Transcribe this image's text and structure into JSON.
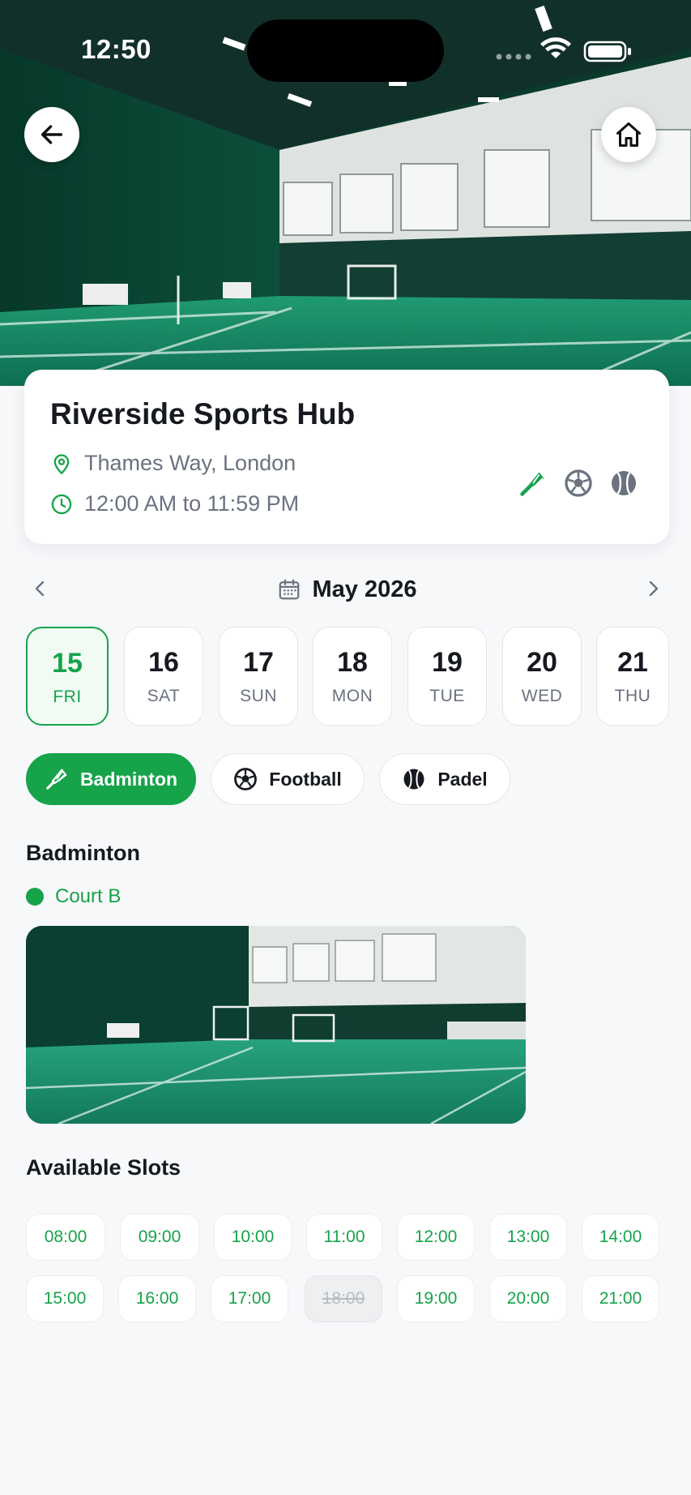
{
  "status_bar": {
    "time": "12:50"
  },
  "venue": {
    "name": "Riverside Sports Hub",
    "address": "Thames Way, London",
    "hours": "12:00 AM to 11:59 PM",
    "sport_icons": [
      "shuttlecock-icon",
      "football-icon",
      "padel-ball-icon"
    ]
  },
  "calendar": {
    "month_label": "May 2026",
    "dates": [
      {
        "num": "15",
        "day": "FRI",
        "selected": true
      },
      {
        "num": "16",
        "day": "SAT",
        "selected": false
      },
      {
        "num": "17",
        "day": "SUN",
        "selected": false
      },
      {
        "num": "18",
        "day": "MON",
        "selected": false
      },
      {
        "num": "19",
        "day": "TUE",
        "selected": false
      },
      {
        "num": "20",
        "day": "WED",
        "selected": false
      },
      {
        "num": "21",
        "day": "THU",
        "selected": false
      }
    ]
  },
  "sports": [
    {
      "label": "Badminton",
      "icon": "shuttlecock-icon",
      "selected": true
    },
    {
      "label": "Football",
      "icon": "football-icon",
      "selected": false
    },
    {
      "label": "Padel",
      "icon": "padel-ball-icon",
      "selected": false
    }
  ],
  "court_section": {
    "title": "Badminton",
    "court_name": "Court B"
  },
  "slots_section": {
    "title": "Available Slots",
    "slots": [
      {
        "time": "08:00",
        "available": true
      },
      {
        "time": "09:00",
        "available": true
      },
      {
        "time": "10:00",
        "available": true
      },
      {
        "time": "11:00",
        "available": true
      },
      {
        "time": "12:00",
        "available": true
      },
      {
        "time": "13:00",
        "available": true
      },
      {
        "time": "14:00",
        "available": true
      },
      {
        "time": "15:00",
        "available": true
      },
      {
        "time": "16:00",
        "available": true
      },
      {
        "time": "17:00",
        "available": true
      },
      {
        "time": "18:00",
        "available": false
      },
      {
        "time": "19:00",
        "available": true
      },
      {
        "time": "20:00",
        "available": true
      },
      {
        "time": "21:00",
        "available": true
      }
    ]
  },
  "colors": {
    "accent": "#16a34a",
    "background": "#f7f8fa",
    "text_primary": "#16191f",
    "text_secondary": "#6b7280"
  }
}
